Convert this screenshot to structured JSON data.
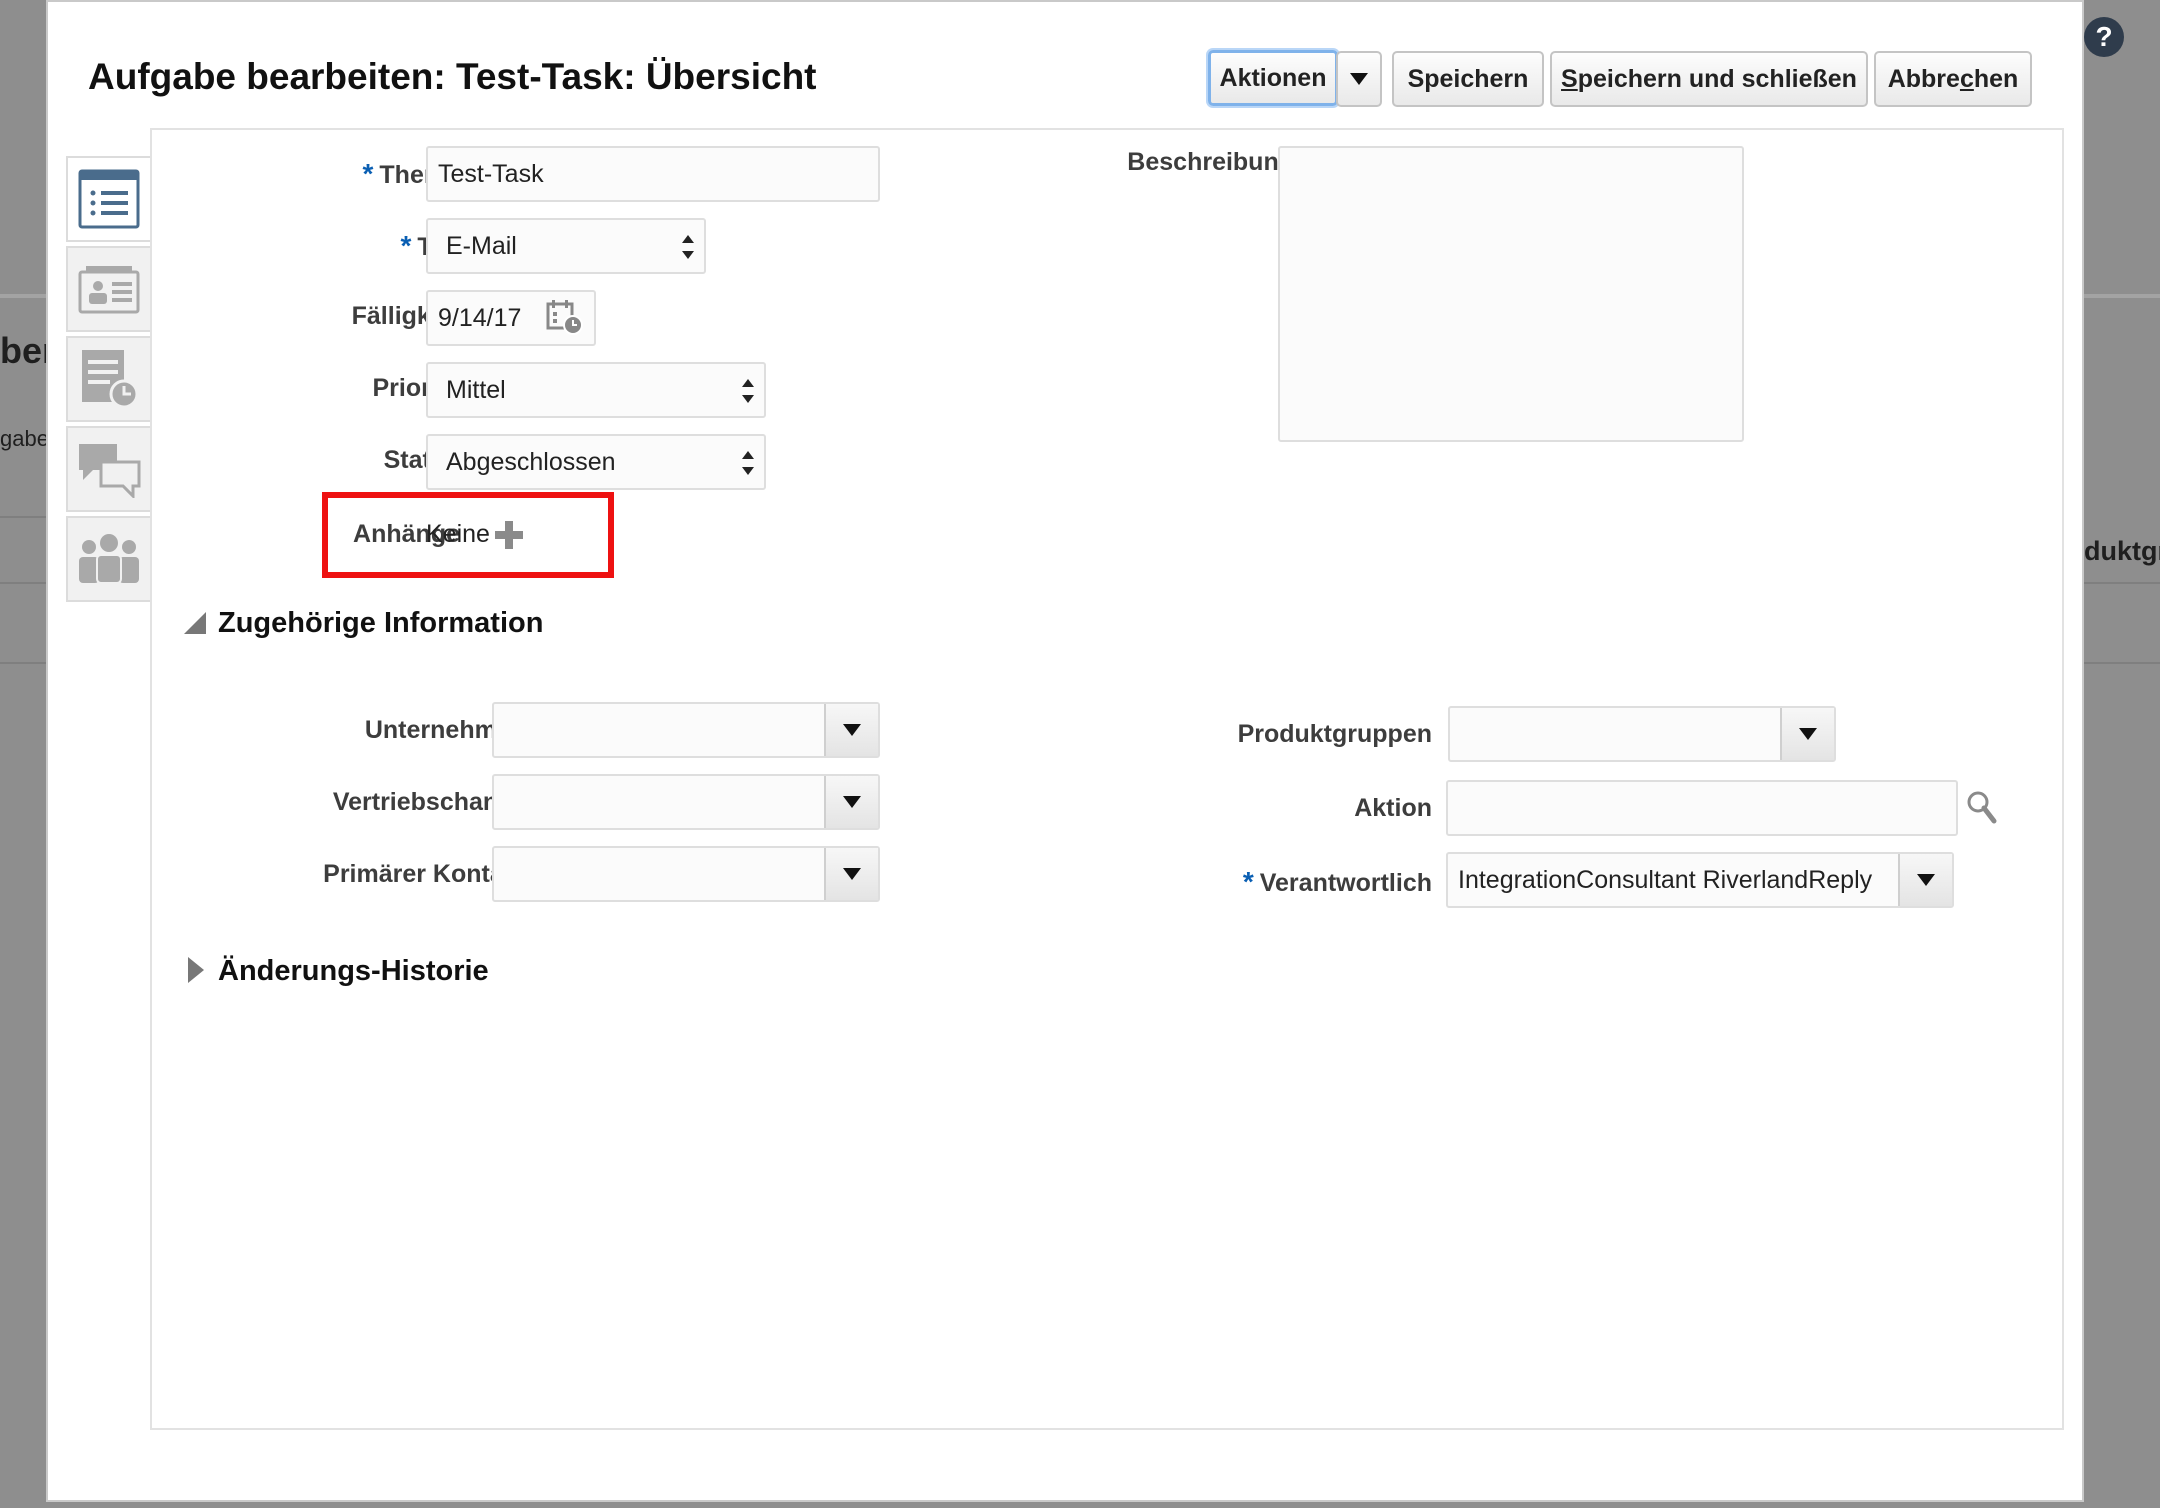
{
  "background": {
    "fragment_1": "ben",
    "fragment_2": "gabe",
    "fragment_3": "duktgr"
  },
  "dialog": {
    "title": "Aufgabe bearbeiten: Test-Task: Übersicht",
    "buttons": {
      "actions": "Aktionen",
      "save": "Speichern",
      "save_close": "Speichern und schließen",
      "cancel_pre": "Abbre",
      "cancel_mnemonic": "c",
      "cancel_post": "hen",
      "save_close_mnemonic": "S",
      "save_close_rest": "peichern und schließen"
    }
  },
  "side_tabs": [
    {
      "icon": "summary-list-icon"
    },
    {
      "icon": "contact-card-icon"
    },
    {
      "icon": "document-clock-icon"
    },
    {
      "icon": "conversation-icon"
    },
    {
      "icon": "team-icon"
    }
  ],
  "form": {
    "thema": {
      "label": "Thema",
      "value": "Test-Task",
      "required": true
    },
    "typ": {
      "label": "Typ",
      "value": "E-Mail",
      "required": true
    },
    "faelligkeit": {
      "label": "Fälligkeit",
      "value": "9/14/17"
    },
    "priority": {
      "label": "Priority",
      "value": "Mittel"
    },
    "status": {
      "label": "Status",
      "value": "Abgeschlossen"
    },
    "anhaenge": {
      "label": "Anhänge",
      "value": "Keine"
    },
    "beschreibung": {
      "label": "Beschreibung",
      "value": ""
    }
  },
  "related": {
    "title": "Zugehörige Information",
    "unternehmen": {
      "label": "Unternehmen",
      "value": ""
    },
    "vertriebschance": {
      "label": "Vertriebschance",
      "value": ""
    },
    "primaerer_kontakt": {
      "label": "Primärer Kontakt",
      "value": ""
    },
    "produktgruppen": {
      "label": "Produktgruppen",
      "value": ""
    },
    "aktion": {
      "label": "Aktion",
      "value": ""
    },
    "verantwortlich": {
      "label": "Verantwortlich",
      "value": "IntegrationConsultant RiverlandReply",
      "required": true
    }
  },
  "history": {
    "title": "Änderungs-Historie"
  },
  "colors": {
    "required_marker": "#0a5fb3",
    "highlight": "#ee1111",
    "focus_ring": "#7fb2ea"
  }
}
